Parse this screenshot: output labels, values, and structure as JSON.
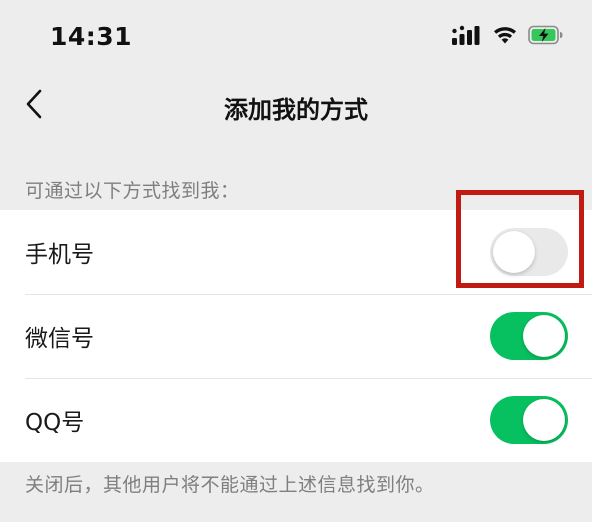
{
  "status_bar": {
    "time": "14:31",
    "icons": [
      "cellular-signal-icon",
      "wifi-icon",
      "battery-charging-icon"
    ],
    "battery_color": "#34c759"
  },
  "nav": {
    "back_icon": "chevron-left-icon",
    "title": "添加我的方式"
  },
  "section": {
    "header": "可通过以下方式找到我："
  },
  "items": [
    {
      "label": "手机号",
      "enabled": false
    },
    {
      "label": "微信号",
      "enabled": true
    },
    {
      "label": "QQ号",
      "enabled": true
    }
  ],
  "footer": {
    "note": "关闭后，其他用户将不能通过上述信息找到你。"
  },
  "colors": {
    "background": "#ededed",
    "toggle_on": "#07c160",
    "toggle_off": "#e9e9ea",
    "highlight": "#c01a12"
  }
}
